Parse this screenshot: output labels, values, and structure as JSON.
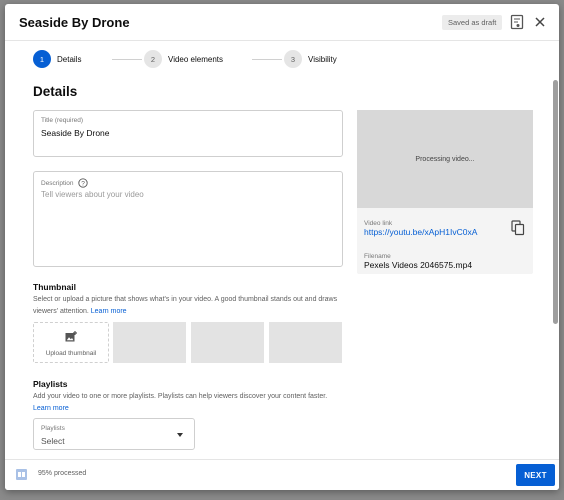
{
  "header": {
    "title": "Seaside By Drone",
    "draft_badge": "Saved as draft"
  },
  "icons": {
    "feedback": "feedback-icon",
    "close": "close-icon",
    "info": "info-icon",
    "add_photo": "add-photo-icon",
    "copy": "copy-icon",
    "processing": "processing-icon",
    "dropdown": "dropdown-caret-icon"
  },
  "stepper": {
    "steps": [
      {
        "number": "1",
        "label": "Details",
        "active": true
      },
      {
        "number": "2",
        "label": "Video elements",
        "active": false
      },
      {
        "number": "3",
        "label": "Visibility",
        "active": false
      }
    ]
  },
  "details": {
    "heading": "Details",
    "title_field": {
      "label": "Title (required)",
      "value": "Seaside By Drone"
    },
    "description_field": {
      "label": "Description",
      "placeholder": "Tell viewers about your video"
    }
  },
  "thumbnail": {
    "title": "Thumbnail",
    "description": "Select or upload a picture that shows what's in your video. A good thumbnail stands out and draws viewers' attention.",
    "learn_more": "Learn more",
    "upload_label": "Upload thumbnail"
  },
  "playlists": {
    "title": "Playlists",
    "description": "Add your video to one or more playlists. Playlists can help viewers discover your content faster.",
    "learn_more": "Learn more",
    "select_label": "Playlists",
    "select_value": "Select"
  },
  "side_panel": {
    "processing_text": "Processing video...",
    "video_link_label": "Video link",
    "video_link": "https://youtu.be/xApH1IvC0xA",
    "filename_label": "Filename",
    "filename": "Pexels Videos 2046575.mp4"
  },
  "footer": {
    "processed_text": "95% processed",
    "processed_fraction": 0.95,
    "next_label": "NEXT"
  },
  "colors": {
    "accent": "#065fd4",
    "badge_bg": "#ececec"
  }
}
